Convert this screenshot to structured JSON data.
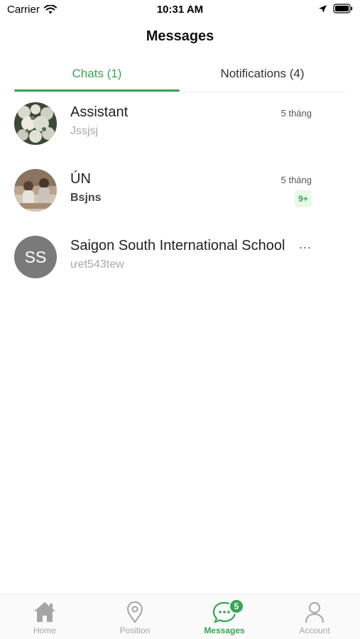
{
  "status_bar": {
    "carrier": "Carrier",
    "time": "10:31 AM"
  },
  "header": {
    "title": "Messages"
  },
  "tabs": [
    {
      "label": "Chats (1)",
      "active": true
    },
    {
      "label": "Notifications (4)",
      "active": false
    }
  ],
  "chats": [
    {
      "name": "Assistant",
      "preview": "Jssjsj",
      "time": "5 tháng",
      "avatar": "photo-flowers",
      "unread": false
    },
    {
      "name": "ÚN",
      "preview": "Bsjns",
      "time": "5 tháng",
      "avatar": "photo-people",
      "unread": true,
      "badge": "9+"
    },
    {
      "name": "Saigon South International School",
      "preview": "ưet543tew",
      "avatar_initials": "SS",
      "more": "...",
      "unread": false
    }
  ],
  "bottom_nav": {
    "items": [
      {
        "label": "Home",
        "icon": "home-icon",
        "active": false
      },
      {
        "label": "Position",
        "icon": "location-pin-icon",
        "active": false
      },
      {
        "label": "Messages",
        "icon": "chat-bubble-icon",
        "active": true,
        "badge": "5"
      },
      {
        "label": "Account",
        "icon": "user-icon",
        "active": false
      }
    ]
  },
  "colors": {
    "accent": "#34a853",
    "badge_bg": "#eaf8ec",
    "inactive": "#a5a5a5"
  }
}
